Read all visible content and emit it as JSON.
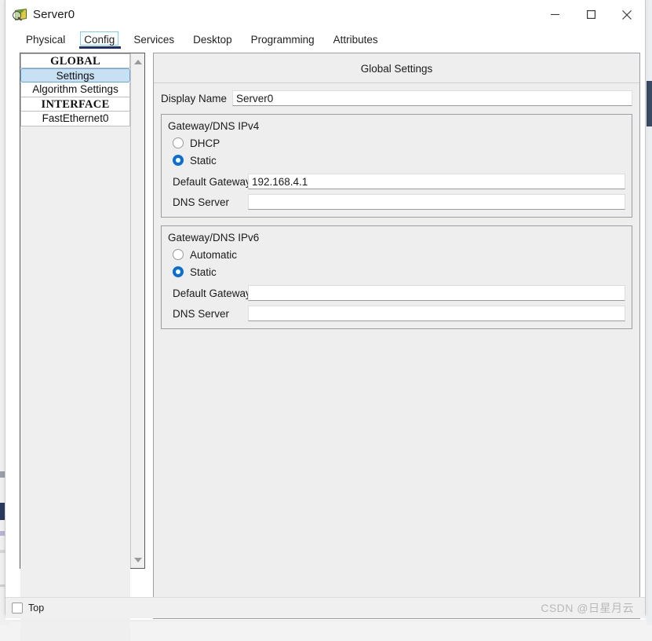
{
  "window": {
    "title": "Server0",
    "icon": "server-magnifier-icon",
    "minimize_label": "—",
    "maximize_label": "□",
    "close_label": "✕"
  },
  "tabs": [
    {
      "label": "Physical",
      "selected": false
    },
    {
      "label": "Config",
      "selected": true
    },
    {
      "label": "Services",
      "selected": false
    },
    {
      "label": "Desktop",
      "selected": false
    },
    {
      "label": "Programming",
      "selected": false
    },
    {
      "label": "Attributes",
      "selected": false
    }
  ],
  "sidebar": {
    "items": [
      {
        "label": "GLOBAL",
        "type": "header",
        "selected": false
      },
      {
        "label": "Settings",
        "type": "item",
        "selected": true
      },
      {
        "label": "Algorithm Settings",
        "type": "item",
        "selected": false
      },
      {
        "label": "INTERFACE",
        "type": "header",
        "selected": false
      },
      {
        "label": "FastEthernet0",
        "type": "item",
        "selected": false
      }
    ],
    "scroll_up_icon": "triangle-up-icon",
    "scroll_down_icon": "triangle-down-icon"
  },
  "panel": {
    "title": "Global Settings",
    "display_name": {
      "label": "Display Name",
      "value": "Server0",
      "placeholder": ""
    },
    "ipv4": {
      "legend": "Gateway/DNS IPv4",
      "options": [
        {
          "label": "DHCP",
          "selected": false
        },
        {
          "label": "Static",
          "selected": true
        }
      ],
      "fields": [
        {
          "label": "Default Gateway",
          "value": "192.168.4.1",
          "placeholder": ""
        },
        {
          "label": "DNS Server",
          "value": "",
          "placeholder": ""
        }
      ]
    },
    "ipv6": {
      "legend": "Gateway/DNS IPv6",
      "options": [
        {
          "label": "Automatic",
          "selected": false
        },
        {
          "label": "Static",
          "selected": true
        }
      ],
      "fields": [
        {
          "label": "Default Gateway",
          "value": "",
          "placeholder": ""
        },
        {
          "label": "DNS Server",
          "value": "",
          "placeholder": ""
        }
      ]
    }
  },
  "bottom": {
    "top_checkbox_label": "Top",
    "top_checkbox_checked": false,
    "watermark": "CSDN @日星月云"
  },
  "colors": {
    "accent_blue": "#0a6fd0",
    "selection_blue": "#c8e0f4",
    "tab_underline": "#1b2f6b",
    "focus_ring": "#7fd0f0",
    "panel_bg": "#eeeeee"
  }
}
